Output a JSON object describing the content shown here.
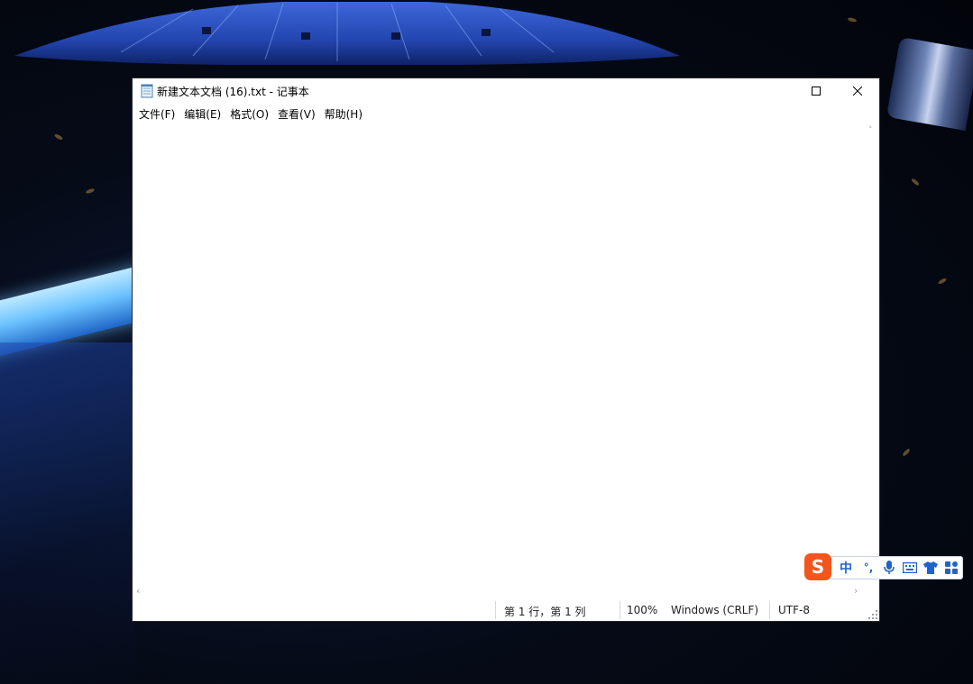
{
  "window": {
    "title": "新建文本文档 (16).txt - 记事本"
  },
  "menu": [
    {
      "label": "文件(F)"
    },
    {
      "label": "编辑(E)"
    },
    {
      "label": "格式(O)"
    },
    {
      "label": "查看(V)"
    },
    {
      "label": "帮助(H)"
    }
  ],
  "editor": {
    "content": ""
  },
  "status": {
    "position": "第 1 行，第 1 列",
    "zoom": "100%",
    "line_ending": "Windows (CRLF)",
    "encoding": "UTF-8"
  },
  "ime": {
    "logo": "S",
    "mode": "中",
    "punctuation": "°,"
  },
  "icons": {
    "app": "notepad-icon",
    "maximize": "maximize-icon",
    "close": "close-icon",
    "ime_logo": "sogou-logo",
    "mic": "microphone-icon",
    "keyboard": "keyboard-icon",
    "skin": "tshirt-icon",
    "toolbox": "grid-icon"
  },
  "colors": {
    "ime_accent": "#1e64c8",
    "ime_logo": "#f2561d"
  }
}
